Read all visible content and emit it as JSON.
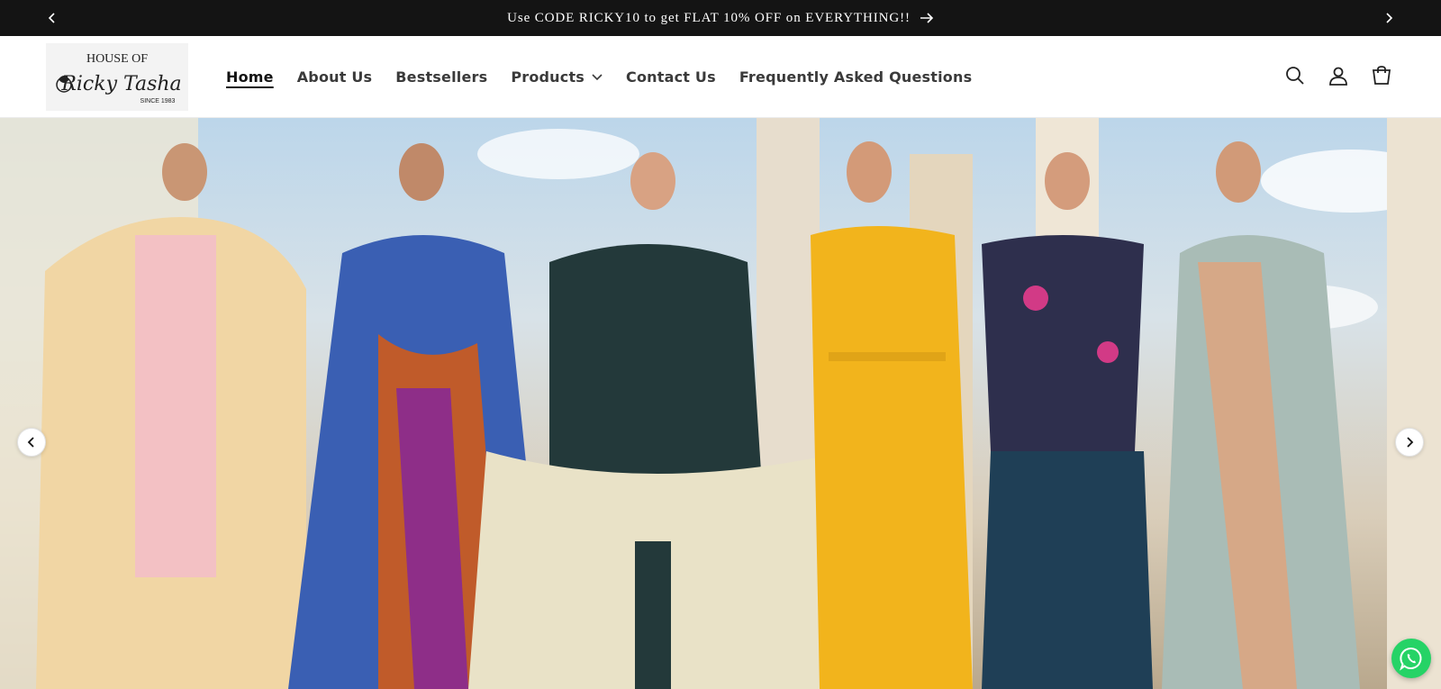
{
  "announcement": {
    "text": "Use CODE RICKY10 to get FLAT 10% OFF on EVERYTHING!!",
    "prev_icon": "chevron-left-icon",
    "next_icon": "chevron-right-icon",
    "arrow_icon": "arrow-right-icon"
  },
  "logo": {
    "line1": "HOUSE OF",
    "line2": "Ricky Tasha",
    "line3": "SINCE 1983"
  },
  "nav": {
    "items": [
      {
        "label": "Home",
        "active": true
      },
      {
        "label": "About Us"
      },
      {
        "label": "Bestsellers"
      },
      {
        "label": "Products",
        "has_dropdown": true
      },
      {
        "label": "Contact Us"
      },
      {
        "label": "Frequently Asked Questions"
      }
    ]
  },
  "header_icons": [
    "search-icon",
    "account-icon",
    "cart-icon"
  ],
  "hero": {
    "image_desc": "six-models-ethnic-wear-banner",
    "prev_icon": "chevron-left-icon",
    "next_icon": "chevron-right-icon"
  },
  "whatsapp": {
    "icon": "whatsapp-icon"
  },
  "colors": {
    "announce_bg": "#141414",
    "accent_yellow": "#f2b41c",
    "text_dark": "#121212",
    "whatsapp_green": "#25d366"
  }
}
